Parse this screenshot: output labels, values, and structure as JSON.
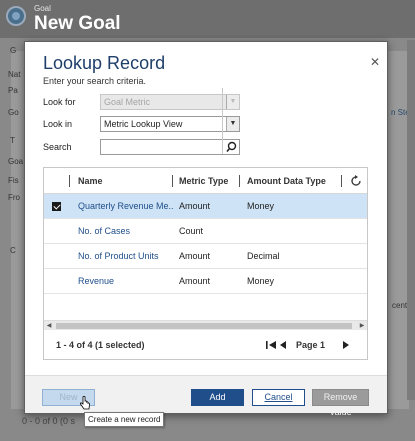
{
  "background": {
    "entity_label": "Goal",
    "page_title": "New Goal",
    "fragments": [
      "Nat",
      "Pa",
      "Go",
      "Goa",
      "Fis",
      "Fro",
      "G",
      "T",
      "C"
    ],
    "right_fragments": [
      "n Ste",
      "centa"
    ],
    "footer_status": "0 - 0 of 0 (0 s"
  },
  "dialog": {
    "title": "Lookup Record",
    "subtitle": "Enter your search criteria.",
    "look_for_label": "Look for",
    "look_for_value": "Goal Metric",
    "look_in_label": "Look in",
    "look_in_value": "Metric Lookup View",
    "search_label": "Search",
    "search_value": "",
    "close_icon": "close-icon"
  },
  "grid": {
    "columns": [
      "Name",
      "Metric Type",
      "Amount Data Type"
    ],
    "rows": [
      {
        "name": "Quarterly Revenue Me...",
        "metric_type": "Amount",
        "amount_data_type": "Money",
        "selected": true
      },
      {
        "name": "No. of Cases",
        "metric_type": "Count",
        "amount_data_type": "",
        "selected": false
      },
      {
        "name": "No. of Product Units",
        "metric_type": "Amount",
        "amount_data_type": "Decimal",
        "selected": false
      },
      {
        "name": "Revenue",
        "metric_type": "Amount",
        "amount_data_type": "Money",
        "selected": false
      }
    ],
    "status": "1 - 4 of 4 (1 selected)",
    "page": "Page 1"
  },
  "buttons": {
    "new": "New",
    "add": "Add",
    "cancel": "Cancel",
    "remove": "Remove Value"
  },
  "tooltip": "Create a new record",
  "colors": {
    "accent": "#1f4e8a",
    "link": "#1f4e8a",
    "selected_row": "#cfe3f6",
    "title": "#1f3f6b"
  }
}
